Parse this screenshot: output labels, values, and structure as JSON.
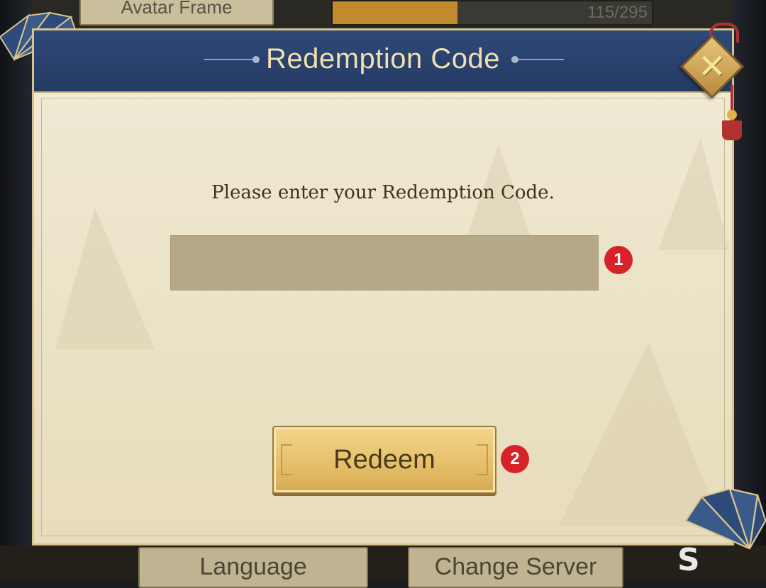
{
  "background": {
    "top_button_label": "Avatar Frame",
    "progress_text": "115/295",
    "progress_fraction": 0.39,
    "bottom_left_button_label": "Language",
    "bottom_right_button_label": "Change Server"
  },
  "modal": {
    "title": "Redemption Code",
    "prompt": "Please enter your Redemption Code.",
    "code_input": {
      "value": "",
      "placeholder": ""
    },
    "redeem_label": "Redeem",
    "close_icon": "close-icon"
  },
  "annotations": [
    {
      "label": "1"
    },
    {
      "label": "2"
    }
  ],
  "colors": {
    "header": "#2f4978",
    "title": "#f0dfb0",
    "input": "#b6a887",
    "button": "#e7c06a",
    "badge": "#d8222a"
  }
}
